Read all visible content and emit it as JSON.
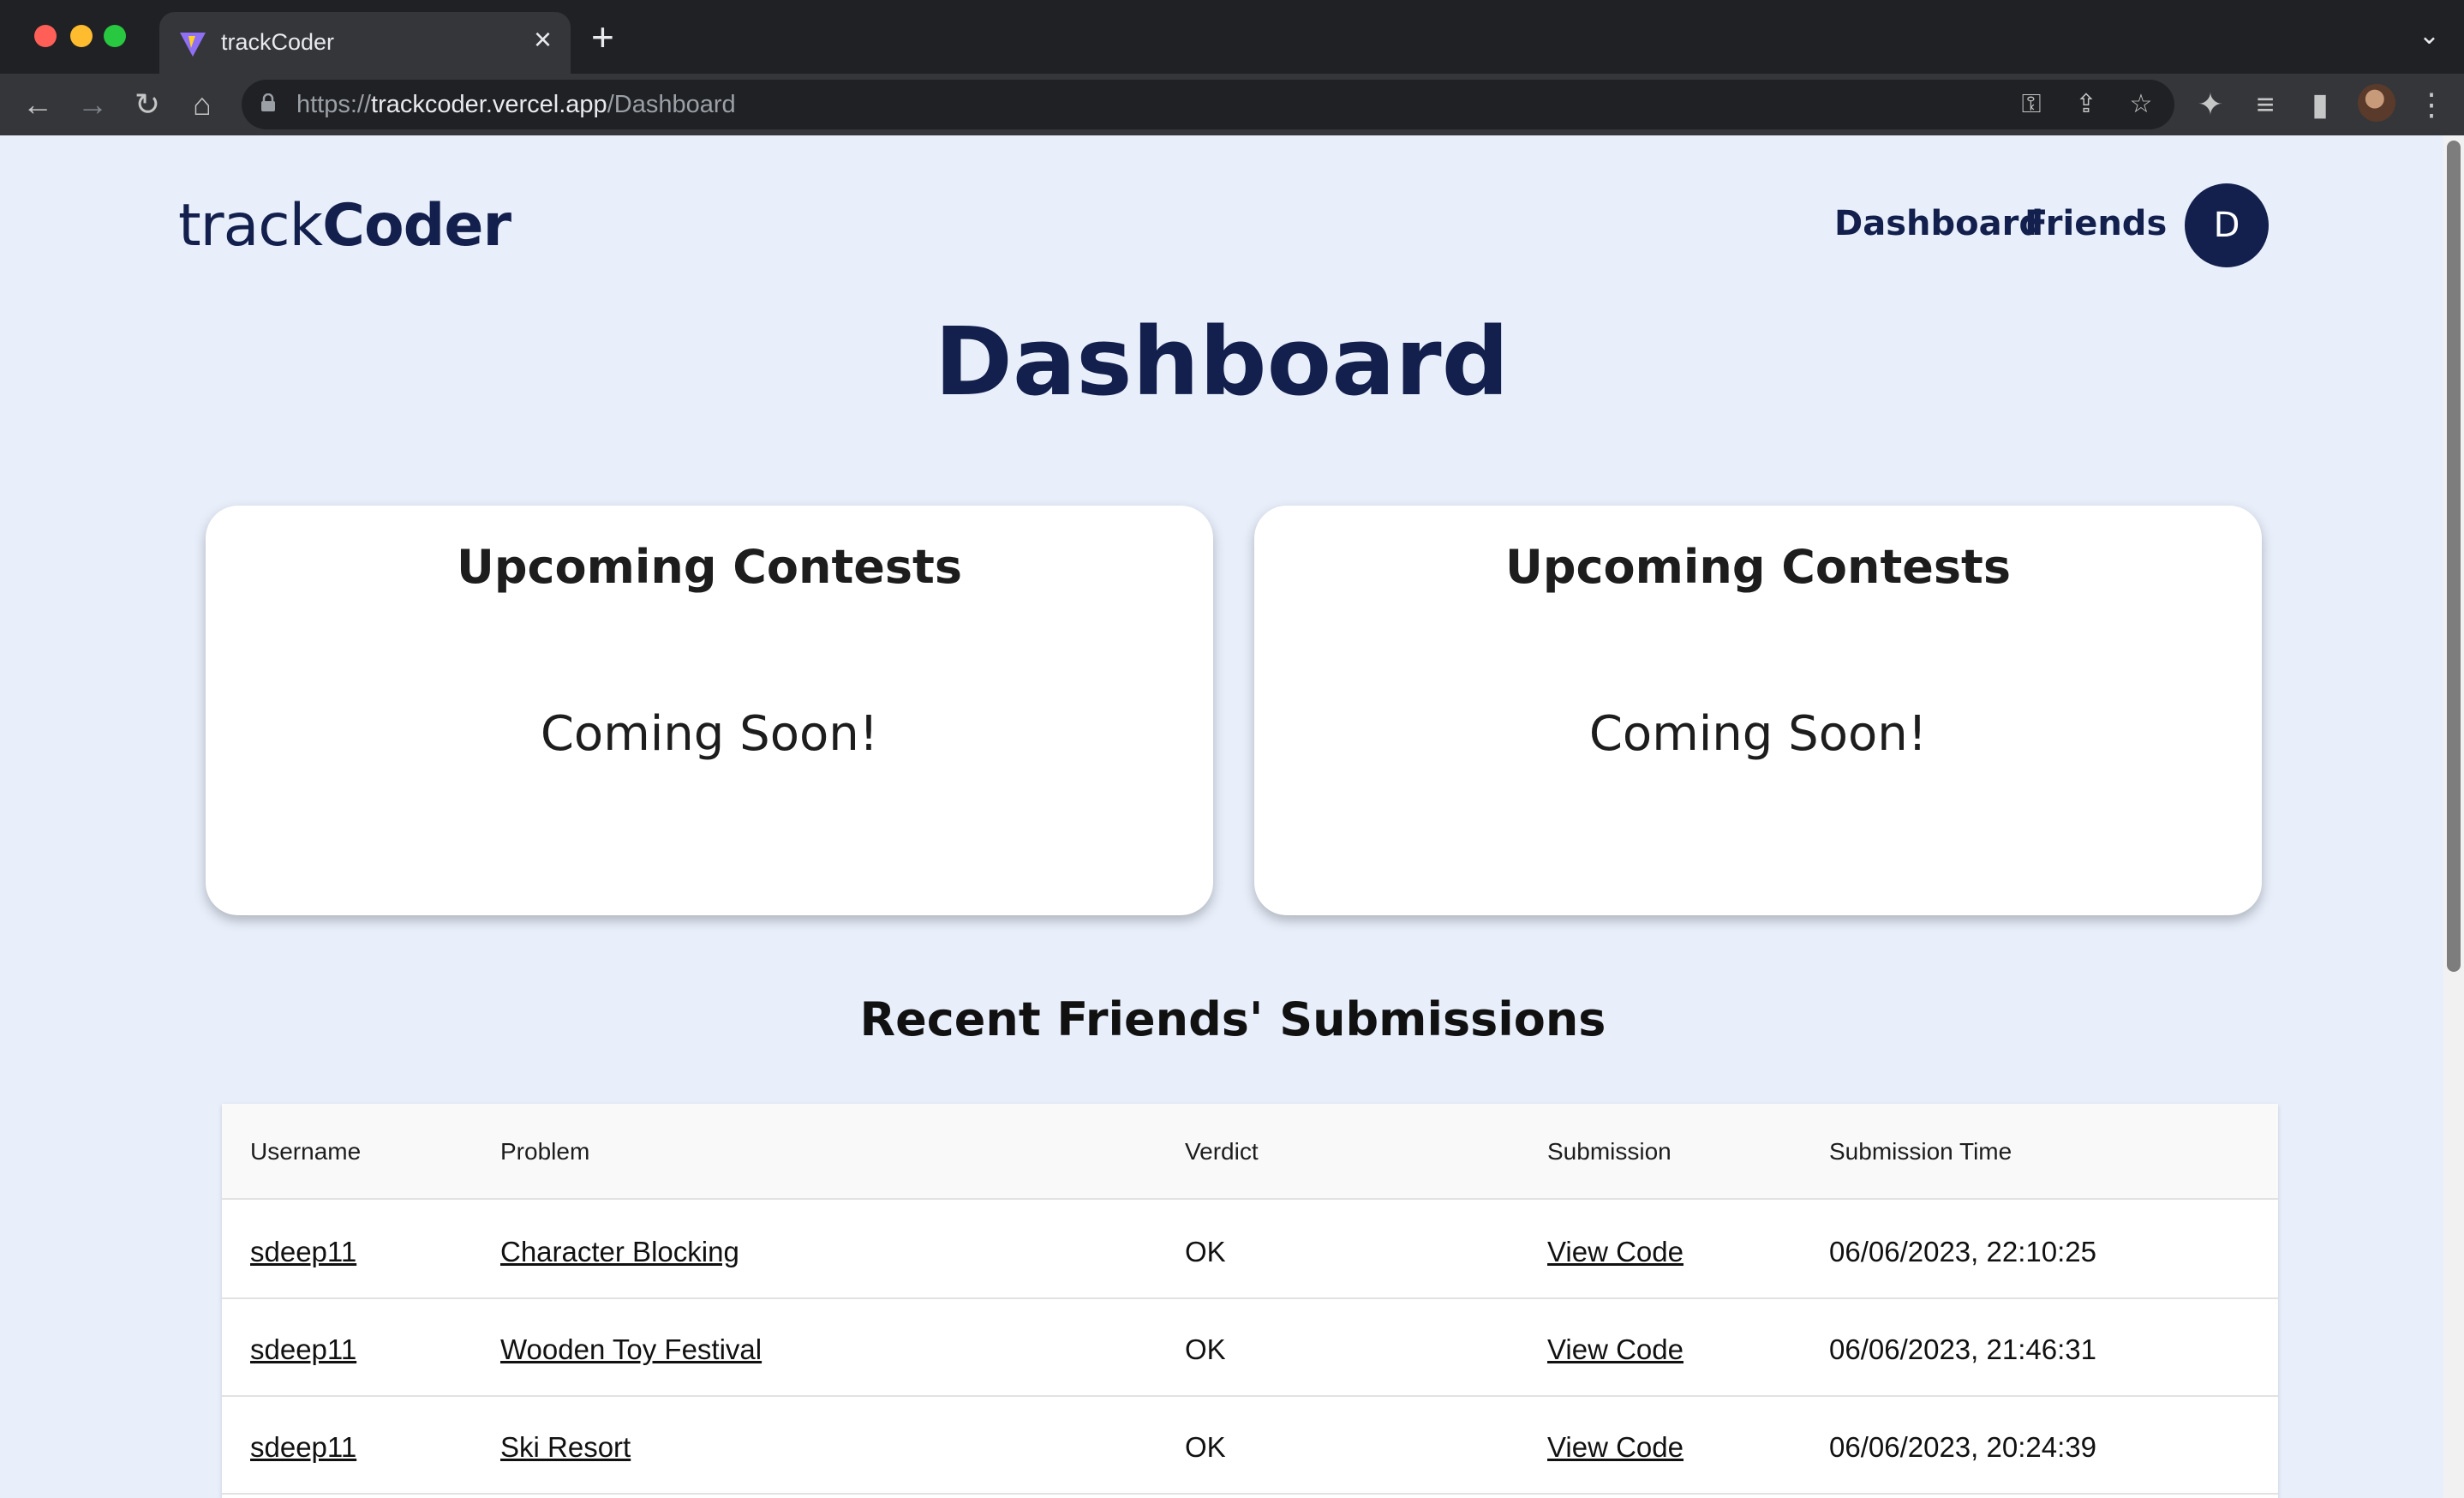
{
  "browser": {
    "tab_title": "trackCoder",
    "url_scheme": "https://",
    "url_host": "trackcoder.vercel.app",
    "url_path": "/Dashboard"
  },
  "header": {
    "logo_light": "track",
    "logo_bold": "Coder",
    "nav": [
      {
        "label": "Dashboard"
      },
      {
        "label": "Friends"
      }
    ],
    "avatar_initial": "D"
  },
  "page_title": "Dashboard",
  "cards": [
    {
      "title": "Upcoming Contests",
      "body": "Coming Soon!"
    },
    {
      "title": "Upcoming Contests",
      "body": "Coming Soon!"
    }
  ],
  "submissions": {
    "title": "Recent Friends' Submissions",
    "columns": [
      "Username",
      "Problem",
      "Verdict",
      "Submission",
      "Submission Time"
    ],
    "rows": [
      {
        "username": "sdeep11",
        "problem": "Character Blocking",
        "verdict": "OK",
        "submission": "View Code",
        "time": "06/06/2023, 22:10:25"
      },
      {
        "username": "sdeep11",
        "problem": "Wooden Toy Festival",
        "verdict": "OK",
        "submission": "View Code",
        "time": "06/06/2023, 21:46:31"
      },
      {
        "username": "sdeep11",
        "problem": "Ski Resort",
        "verdict": "OK",
        "submission": "View Code",
        "time": "06/06/2023, 20:24:39"
      }
    ]
  },
  "colors": {
    "brand_navy": "#13204d",
    "page_bg": "#e8effb"
  }
}
